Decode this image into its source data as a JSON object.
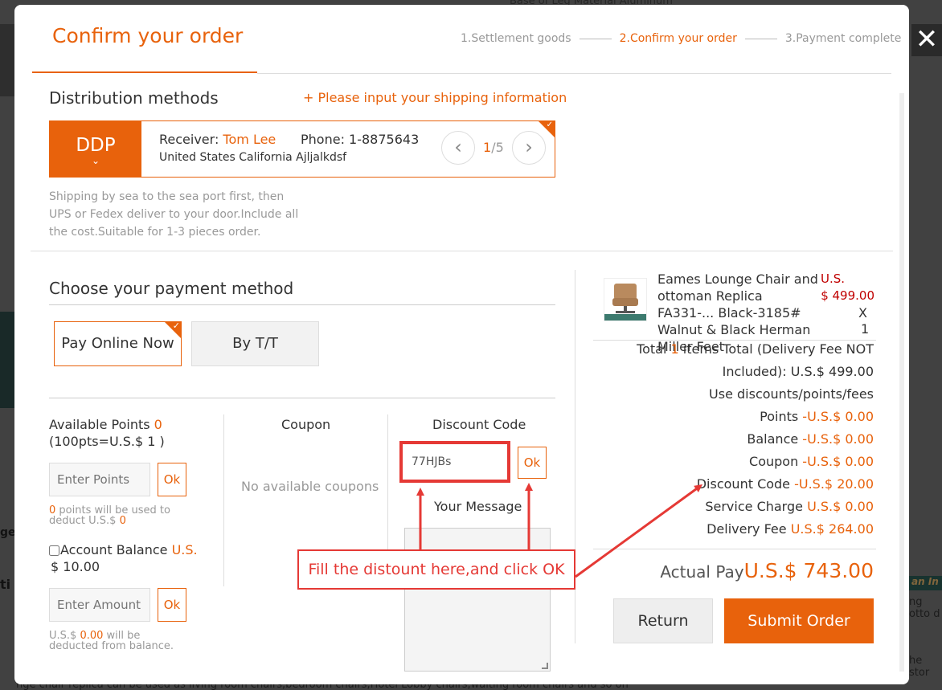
{
  "background": {
    "top_text": "Base of Leg Material    Aluminum",
    "left_text": "ge",
    "left_text2": "ti",
    "bottom_text": "nge chair replica can be used as living room chairs,bedroom chairs,Hotel Lobby chairs,waiting room chairs and so on",
    "right_tag": "an In",
    "right_text": "ng otto d",
    "right_text2": "he stor"
  },
  "close_icon": "✕",
  "header": {
    "title": "Confirm your order",
    "steps": [
      "1.Settlement goods",
      "2.Confirm your order",
      "3.Payment complete"
    ],
    "active_step": 1
  },
  "distribution": {
    "heading": "Distribution methods",
    "hint": "+ Please input your shipping information",
    "method_label": "DDP",
    "receiver_label": "Receiver:",
    "receiver_name": "Tom Lee",
    "phone_label": "Phone:",
    "phone": "1-8875643",
    "address": "United States California Ajljalkdsf",
    "page_current": "1",
    "page_total": "/5",
    "description": "Shipping by sea to the sea port first, then UPS or Fedex deliver to your door.Include all the cost.Suitable for 1-3 pieces order."
  },
  "payment": {
    "heading": "Choose your payment method",
    "option_online": "Pay Online Now",
    "option_tt": "By T/T"
  },
  "points": {
    "label": "Available Points",
    "value": "0",
    "rate": "(100pts=U.S.$  1 )",
    "placeholder": "Enter Points",
    "ok": "Ok",
    "note_num": "0",
    "note_a": " points will be used to",
    "note_b_prefix": "deduct U.S.$ ",
    "note_b_num": "0"
  },
  "balance": {
    "label": "Account Balance",
    "currency": "U.S.",
    "value": "$ 10.00",
    "placeholder": "Enter Amount",
    "ok": "Ok",
    "note_prefix": "U.S.$  ",
    "note_num": "0.00",
    "note_suffix": " will be",
    "note_line2": "deducted from balance."
  },
  "coupon": {
    "heading": "Coupon",
    "empty": "No available coupons"
  },
  "discount": {
    "heading": "Discount Code",
    "value": "77HJBs",
    "ok": "Ok",
    "message_label": "Your Message"
  },
  "summary": {
    "product_name": "Eames Lounge Chair and ottoman Replica FA331-... Black-3185# Walnut & Black Herman Miller Feet",
    "price_currency": "U.S.",
    "price": "$ 499.00",
    "times": "X",
    "qty": "1",
    "total_prefix": "Total ",
    "total_count": "1",
    "total_suffix": " items Total (Delivery Fee NOT",
    "total_line2": "Included):  U.S.$ 499.00",
    "use_discounts": "Use discounts/points/fees",
    "rows": [
      {
        "label": "Points ",
        "value": "-U.S.$ 0.00"
      },
      {
        "label": "Balance ",
        "value": "-U.S.$ 0.00"
      },
      {
        "label": "Coupon ",
        "value": "-U.S.$ 0.00"
      },
      {
        "label": "Discount Code ",
        "value": "-U.S.$ 20.00"
      },
      {
        "label": "Service Charge ",
        "value": "U.S.$ 0.00"
      },
      {
        "label": "Delivery Fee ",
        "value": "U.S.$ 264.00"
      }
    ],
    "actual_label": "Actual Pay",
    "actual_value": "U.S.$ 743.00",
    "return": "Return",
    "submit": "Submit Order"
  },
  "annotation": {
    "text": "Fill the distount here,and click OK"
  },
  "colors": {
    "accent": "#e8620c",
    "annotation": "#e53935",
    "price_red": "#c00000"
  }
}
